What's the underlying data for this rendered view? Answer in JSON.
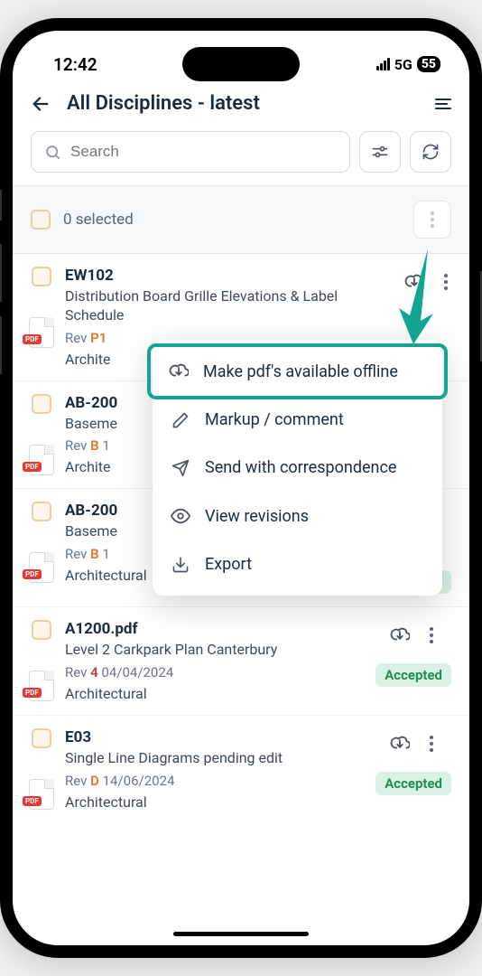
{
  "status": {
    "time": "12:42",
    "network": "5G",
    "battery": "55"
  },
  "header": {
    "title": "All Disciplines - latest"
  },
  "search": {
    "placeholder": "Search"
  },
  "selection": {
    "text": "0 selected"
  },
  "popup": {
    "offline": "Make pdf's available offline",
    "markup": "Markup / comment",
    "send": "Send with correspondence",
    "revisions": "View revisions",
    "export": "Export"
  },
  "badges": {
    "accepted": "Accepted"
  },
  "rev_label": "Rev ",
  "pdf_label": "PDF",
  "items": [
    {
      "code": "EW102",
      "desc": "Distribution Board Grille Elevations & Label Schedule",
      "rev": "P1",
      "rev_color": "#d97b2e",
      "date": "",
      "cat": "Archite",
      "accepted": false
    },
    {
      "code": "AB-200",
      "desc": "Baseme",
      "rev": "B",
      "rev_color": "#d97b2e",
      "date": "1",
      "cat": "Archite",
      "accepted": false
    },
    {
      "code": "AB-200",
      "desc": "Baseme",
      "rev": "B",
      "rev_color": "#d97b2e",
      "date": "1",
      "cat": "Architectural",
      "accepted": true
    },
    {
      "code": "A1200.pdf",
      "desc": "Level 2 Carkpark Plan Canterbury",
      "rev": "4",
      "rev_color": "#c43b3b",
      "date": "04/04/2024",
      "cat": "Architectural",
      "accepted": true
    },
    {
      "code": "E03",
      "desc": "Single Line Diagrams pending edit",
      "rev": "D",
      "rev_color": "#d97b2e",
      "date": "14/06/2024",
      "cat": "Architectural",
      "accepted": true
    }
  ]
}
